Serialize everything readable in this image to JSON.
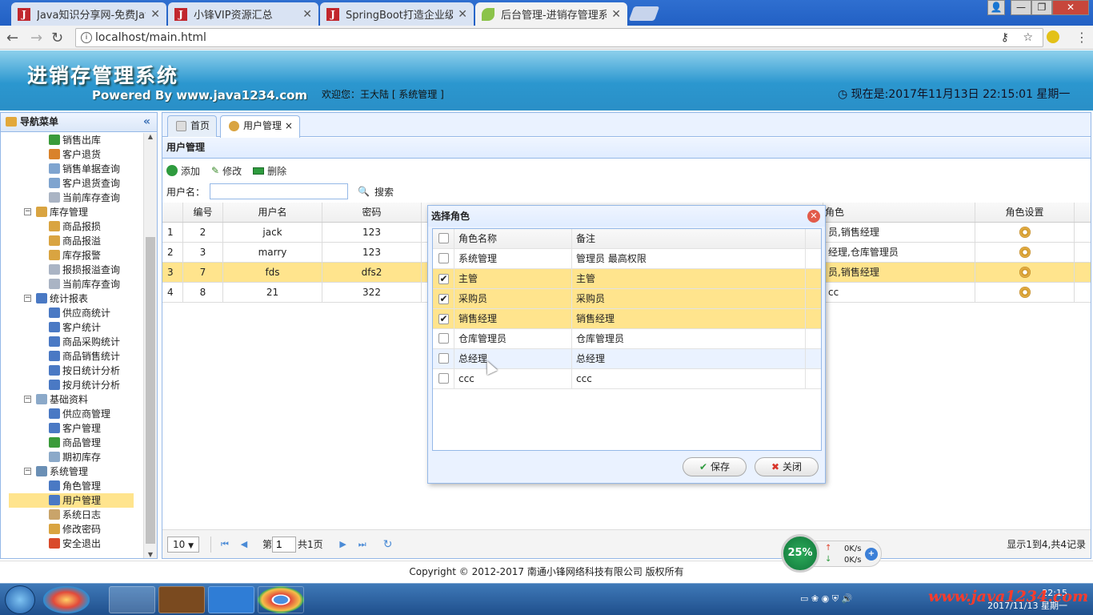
{
  "browser": {
    "tabs": [
      {
        "title": "Java知识分享网-免费Java",
        "icon": "j-icon"
      },
      {
        "title": "小锋VIP资源汇总",
        "icon": "j-icon"
      },
      {
        "title": "SpringBoot打造企业级进",
        "icon": "j-icon"
      },
      {
        "title": "后台管理-进销存管理系统",
        "icon": "leaf-icon"
      }
    ],
    "url": "localhost/main.html"
  },
  "app": {
    "title": "进销存管理系统",
    "powered": "Powered By www.java1234.com",
    "welcome": "欢迎您：王大陆 [ 系统管理 ]",
    "clock": "现在是:2017年11月13日 22:15:01 星期一"
  },
  "sidebar": {
    "header": "导航菜单",
    "items": [
      {
        "label": "销售出库",
        "level": 2,
        "color": "#3a9b3a"
      },
      {
        "label": "客户退货",
        "level": 2,
        "color": "#d9822b"
      },
      {
        "label": "销售单据查询",
        "level": 2,
        "color": "#7fa4cf"
      },
      {
        "label": "客户退货查询",
        "level": 2,
        "color": "#7fa4cf"
      },
      {
        "label": "当前库存查询",
        "level": 2,
        "color": "#aab4c4"
      },
      {
        "label": "库存管理",
        "level": 1,
        "color": "#d9a441"
      },
      {
        "label": "商品报损",
        "level": 2,
        "color": "#d9a441"
      },
      {
        "label": "商品报溢",
        "level": 2,
        "color": "#d9a441"
      },
      {
        "label": "库存报警",
        "level": 2,
        "color": "#d9a441"
      },
      {
        "label": "报损报溢查询",
        "level": 2,
        "color": "#aab4c4"
      },
      {
        "label": "当前库存查询",
        "level": 2,
        "color": "#aab4c4"
      },
      {
        "label": "统计报表",
        "level": 1,
        "color": "#4a79c4"
      },
      {
        "label": "供应商统计",
        "level": 2,
        "color": "#4a79c4"
      },
      {
        "label": "客户统计",
        "level": 2,
        "color": "#4a79c4"
      },
      {
        "label": "商品采购统计",
        "level": 2,
        "color": "#4a79c4"
      },
      {
        "label": "商品销售统计",
        "level": 2,
        "color": "#4a79c4"
      },
      {
        "label": "按日统计分析",
        "level": 2,
        "color": "#4a79c4"
      },
      {
        "label": "按月统计分析",
        "level": 2,
        "color": "#4a79c4"
      },
      {
        "label": "基础资料",
        "level": 1,
        "color": "#8ba9c9"
      },
      {
        "label": "供应商管理",
        "level": 2,
        "color": "#4a79c4"
      },
      {
        "label": "客户管理",
        "level": 2,
        "color": "#4a79c4"
      },
      {
        "label": "商品管理",
        "level": 2,
        "color": "#3a9b3a"
      },
      {
        "label": "期初库存",
        "level": 2,
        "color": "#8ba9c9"
      },
      {
        "label": "系统管理",
        "level": 1,
        "color": "#6a8fb5"
      },
      {
        "label": "角色管理",
        "level": 2,
        "color": "#4a79c4"
      },
      {
        "label": "用户管理",
        "level": 2,
        "color": "#4a79c4",
        "selected": true
      },
      {
        "label": "系统日志",
        "level": 2,
        "color": "#c9a46a"
      },
      {
        "label": "修改密码",
        "level": 2,
        "color": "#d9a441"
      },
      {
        "label": "安全退出",
        "level": 2,
        "color": "#d94a2b"
      }
    ]
  },
  "main": {
    "tabs": [
      {
        "label": "首页"
      },
      {
        "label": "用户管理",
        "close": "×"
      }
    ],
    "panel_title": "用户管理",
    "toolbar": {
      "add": "添加",
      "edit": "修改",
      "delete": "删除"
    },
    "search": {
      "label": "用户名：",
      "value": "",
      "button": "搜索"
    },
    "grid": {
      "headers": [
        "",
        "编号",
        "用户名",
        "密码",
        "",
        "角色",
        "角色设置"
      ],
      "rows": [
        {
          "num": "1",
          "id": "2",
          "name": "jack",
          "pwd": "123",
          "roles": "员,销售经理"
        },
        {
          "num": "2",
          "id": "3",
          "name": "marry",
          "pwd": "123",
          "roles": "经理,仓库管理员"
        },
        {
          "num": "3",
          "id": "7",
          "name": "fds",
          "pwd": "dfs2",
          "roles": "员,销售经理",
          "selected": true
        },
        {
          "num": "4",
          "id": "8",
          "name": "21",
          "pwd": "322",
          "roles": "cc"
        }
      ]
    },
    "pager": {
      "size": "10",
      "page_prefix": "第",
      "page": "1",
      "page_total": "共1页",
      "info": "显示1到4,共4记录"
    }
  },
  "dialog": {
    "title": "选择角色",
    "headers": [
      "角色名称",
      "备注"
    ],
    "rows": [
      {
        "name": "系统管理",
        "note": "管理员 最高权限",
        "checked": false
      },
      {
        "name": "主管",
        "note": "主管",
        "checked": true
      },
      {
        "name": "采购员",
        "note": "采购员",
        "checked": true
      },
      {
        "name": "销售经理",
        "note": "销售经理",
        "checked": true
      },
      {
        "name": "仓库管理员",
        "note": "仓库管理员",
        "checked": false
      },
      {
        "name": "总经理",
        "note": "总经理",
        "checked": false,
        "hover": true
      },
      {
        "name": "ccc",
        "note": "ccc",
        "checked": false
      }
    ],
    "save": "保存",
    "close": "关闭"
  },
  "footer": "Copyright © 2012-2017 南通小锋网络科技有限公司 版权所有",
  "speed": {
    "percent": "25%",
    "up": "0K/s",
    "down": "0K/s"
  },
  "taskbar": {
    "time": "22:15",
    "date": "2017/11/13 星期一",
    "watermark": "www.java1234.com"
  }
}
